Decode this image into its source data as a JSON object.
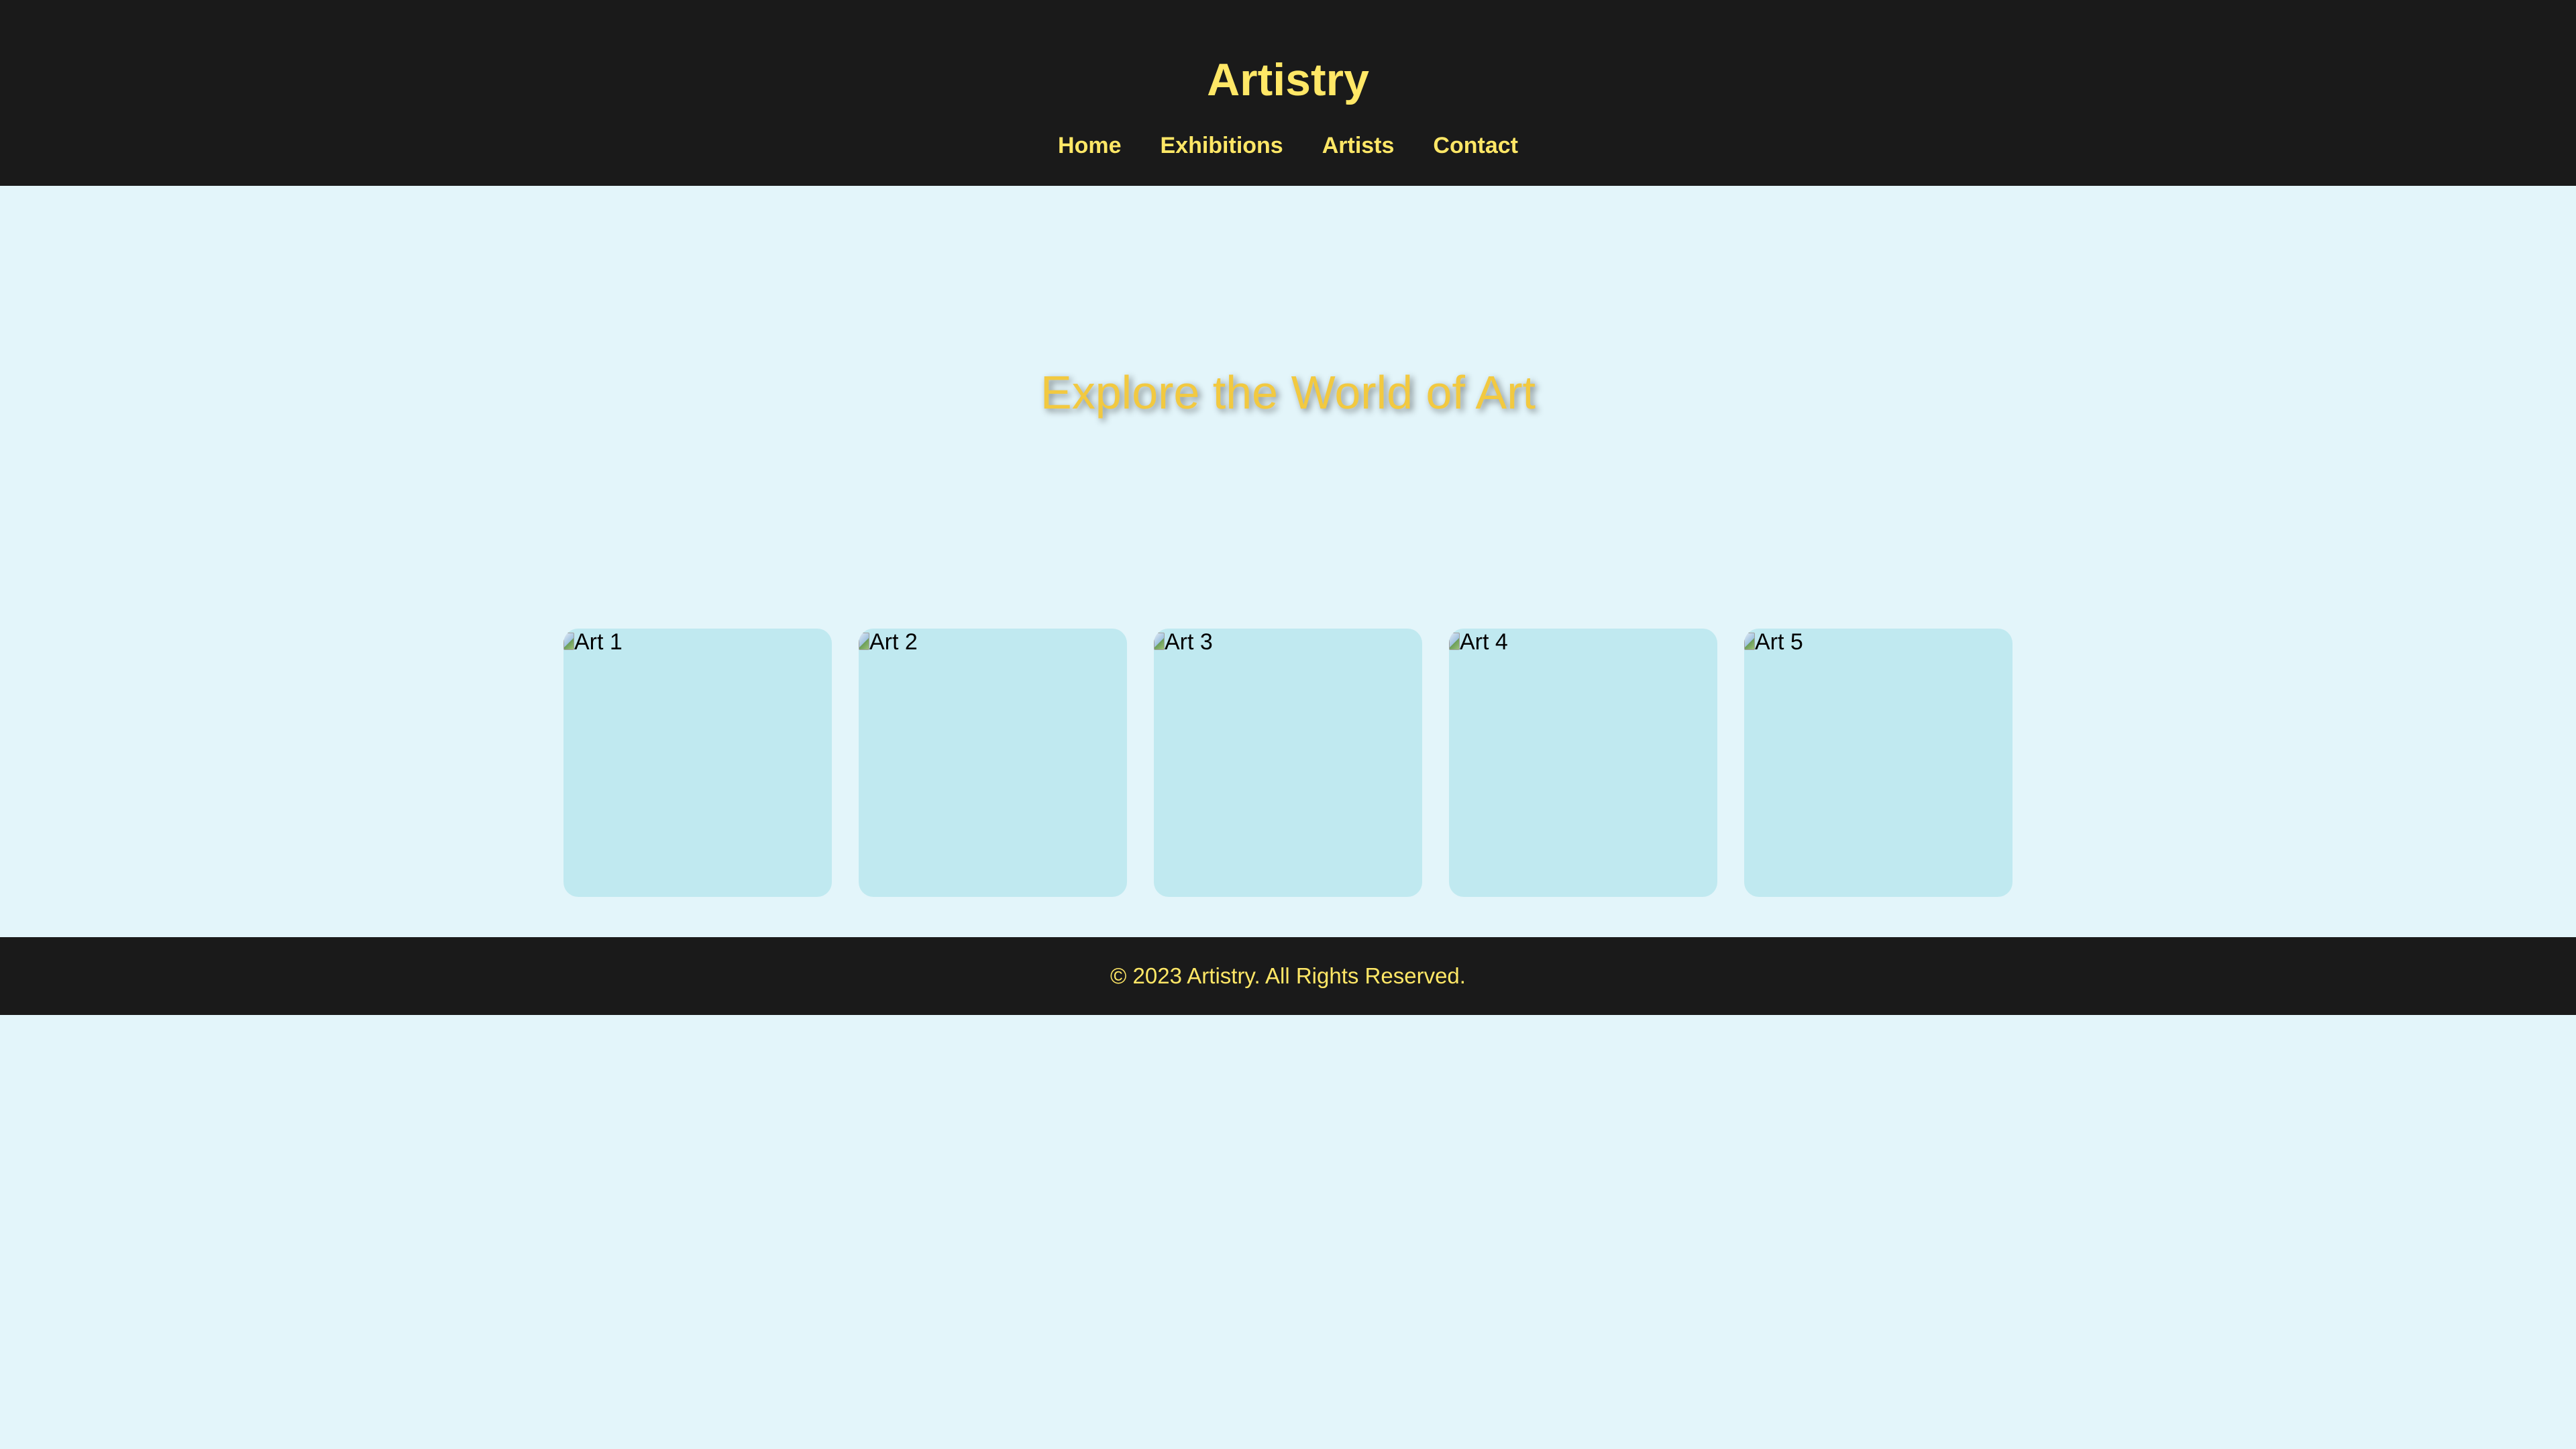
{
  "header": {
    "title": "Artistry",
    "nav": [
      "Home",
      "Exhibitions",
      "Artists",
      "Contact"
    ]
  },
  "hero": {
    "heading": "Explore the World of Art"
  },
  "gallery": {
    "items": [
      {
        "alt": "Art 1"
      },
      {
        "alt": "Art 2"
      },
      {
        "alt": "Art 3"
      },
      {
        "alt": "Art 4"
      },
      {
        "alt": "Art 5"
      }
    ]
  },
  "footer": {
    "text": "© 2023 Artistry. All Rights Reserved."
  },
  "colors": {
    "background": "#e3f5fa",
    "header_bg": "#1a1a1a",
    "accent": "#ffe766",
    "hero_text": "#f2c940",
    "card_bg": "#c0e9f0"
  }
}
